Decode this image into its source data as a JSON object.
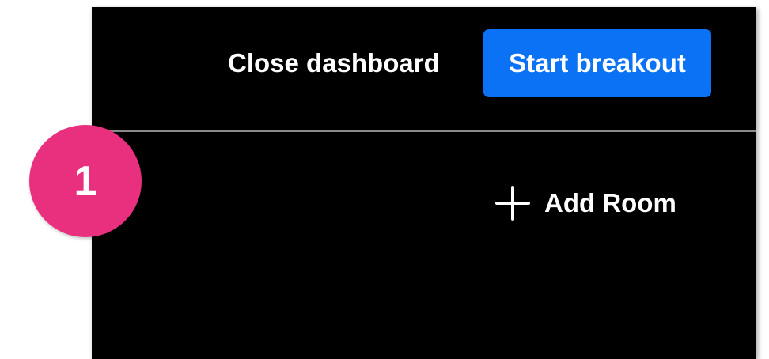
{
  "header": {
    "close_label": "Close dashboard",
    "start_label": "Start breakout"
  },
  "main": {
    "add_room_label": "Add Room",
    "add_room_icon": "plus-icon"
  },
  "annotation": {
    "step_number": "1"
  },
  "colors": {
    "panel_bg": "#000000",
    "primary_button": "#0b72f5",
    "divider": "#8a8a8a",
    "step_badge": "#e8307f",
    "text": "#ffffff"
  }
}
